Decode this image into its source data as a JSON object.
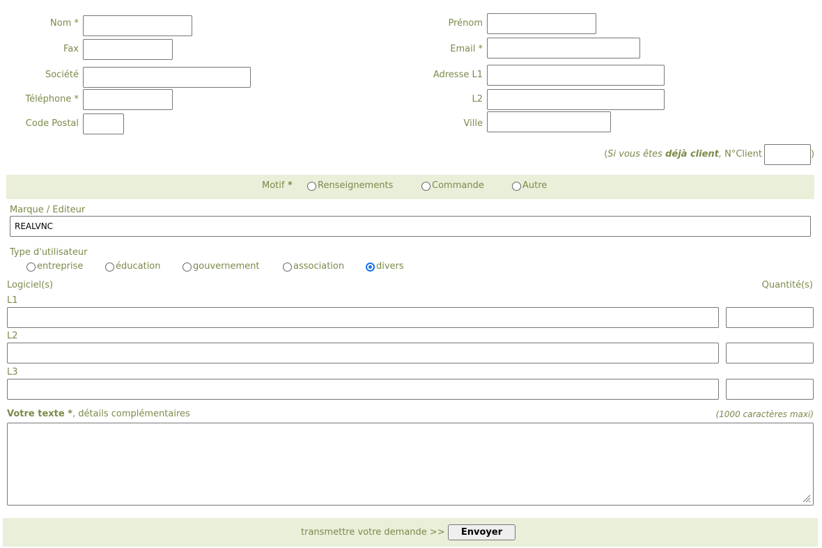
{
  "contact": {
    "nom_label": "Nom *",
    "fax_label": "Fax",
    "societe_label": "Société",
    "telephone_label": "Téléphone *",
    "code_postal_label": "Code Postal",
    "prenom_label": "Prénom",
    "email_label": "Email *",
    "adresse_l1_label": "Adresse L1",
    "l2_label": "L2",
    "ville_label": "Ville"
  },
  "client": {
    "open_paren": "(",
    "si_vous": "Si vous êtes ",
    "deja_client": "déjà client",
    "comma": ",",
    "nclient_label": " N°Client",
    "close_paren": ")"
  },
  "motif": {
    "label": "Motif",
    "star": " *",
    "options": [
      "Renseignements",
      "Commande",
      "Autre"
    ]
  },
  "marque": {
    "label": "Marque / Editeur",
    "value": "REALVNC"
  },
  "type_utilisateur": {
    "label": "Type d'utilisateur",
    "options": [
      "entreprise",
      "éducation",
      "gouvernement",
      "association",
      "divers"
    ],
    "selected": "divers"
  },
  "logiciels": {
    "label": "Logiciel(s)",
    "quantite_label": "Quantité(s)",
    "rows": [
      "L1",
      "L2",
      "L3"
    ]
  },
  "texte": {
    "label_bold": "Votre texte *",
    "label_rest": ", détails complémentaires",
    "max_note": "(1000 caractères maxi)"
  },
  "submit": {
    "prompt": "transmettre votre demande >>",
    "button_label": "Envoyer"
  },
  "colors": {
    "label": "#7a8a4a",
    "band": "#eaefda",
    "radio_checked": "#1a73e8"
  }
}
